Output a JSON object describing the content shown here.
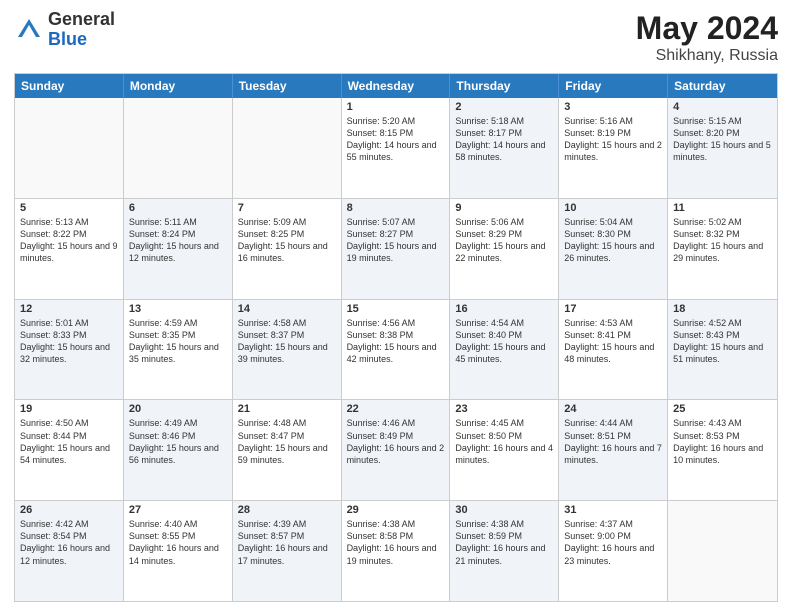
{
  "logo": {
    "general": "General",
    "blue": "Blue"
  },
  "title": {
    "month_year": "May 2024",
    "location": "Shikhany, Russia"
  },
  "header_days": [
    "Sunday",
    "Monday",
    "Tuesday",
    "Wednesday",
    "Thursday",
    "Friday",
    "Saturday"
  ],
  "rows": [
    [
      {
        "day": "",
        "sunrise": "",
        "sunset": "",
        "daylight": "",
        "shaded": false
      },
      {
        "day": "",
        "sunrise": "",
        "sunset": "",
        "daylight": "",
        "shaded": false
      },
      {
        "day": "",
        "sunrise": "",
        "sunset": "",
        "daylight": "",
        "shaded": false
      },
      {
        "day": "1",
        "sunrise": "Sunrise: 5:20 AM",
        "sunset": "Sunset: 8:15 PM",
        "daylight": "Daylight: 14 hours and 55 minutes.",
        "shaded": false
      },
      {
        "day": "2",
        "sunrise": "Sunrise: 5:18 AM",
        "sunset": "Sunset: 8:17 PM",
        "daylight": "Daylight: 14 hours and 58 minutes.",
        "shaded": true
      },
      {
        "day": "3",
        "sunrise": "Sunrise: 5:16 AM",
        "sunset": "Sunset: 8:19 PM",
        "daylight": "Daylight: 15 hours and 2 minutes.",
        "shaded": false
      },
      {
        "day": "4",
        "sunrise": "Sunrise: 5:15 AM",
        "sunset": "Sunset: 8:20 PM",
        "daylight": "Daylight: 15 hours and 5 minutes.",
        "shaded": true
      }
    ],
    [
      {
        "day": "5",
        "sunrise": "Sunrise: 5:13 AM",
        "sunset": "Sunset: 8:22 PM",
        "daylight": "Daylight: 15 hours and 9 minutes.",
        "shaded": false
      },
      {
        "day": "6",
        "sunrise": "Sunrise: 5:11 AM",
        "sunset": "Sunset: 8:24 PM",
        "daylight": "Daylight: 15 hours and 12 minutes.",
        "shaded": true
      },
      {
        "day": "7",
        "sunrise": "Sunrise: 5:09 AM",
        "sunset": "Sunset: 8:25 PM",
        "daylight": "Daylight: 15 hours and 16 minutes.",
        "shaded": false
      },
      {
        "day": "8",
        "sunrise": "Sunrise: 5:07 AM",
        "sunset": "Sunset: 8:27 PM",
        "daylight": "Daylight: 15 hours and 19 minutes.",
        "shaded": true
      },
      {
        "day": "9",
        "sunrise": "Sunrise: 5:06 AM",
        "sunset": "Sunset: 8:29 PM",
        "daylight": "Daylight: 15 hours and 22 minutes.",
        "shaded": false
      },
      {
        "day": "10",
        "sunrise": "Sunrise: 5:04 AM",
        "sunset": "Sunset: 8:30 PM",
        "daylight": "Daylight: 15 hours and 26 minutes.",
        "shaded": true
      },
      {
        "day": "11",
        "sunrise": "Sunrise: 5:02 AM",
        "sunset": "Sunset: 8:32 PM",
        "daylight": "Daylight: 15 hours and 29 minutes.",
        "shaded": false
      }
    ],
    [
      {
        "day": "12",
        "sunrise": "Sunrise: 5:01 AM",
        "sunset": "Sunset: 8:33 PM",
        "daylight": "Daylight: 15 hours and 32 minutes.",
        "shaded": true
      },
      {
        "day": "13",
        "sunrise": "Sunrise: 4:59 AM",
        "sunset": "Sunset: 8:35 PM",
        "daylight": "Daylight: 15 hours and 35 minutes.",
        "shaded": false
      },
      {
        "day": "14",
        "sunrise": "Sunrise: 4:58 AM",
        "sunset": "Sunset: 8:37 PM",
        "daylight": "Daylight: 15 hours and 39 minutes.",
        "shaded": true
      },
      {
        "day": "15",
        "sunrise": "Sunrise: 4:56 AM",
        "sunset": "Sunset: 8:38 PM",
        "daylight": "Daylight: 15 hours and 42 minutes.",
        "shaded": false
      },
      {
        "day": "16",
        "sunrise": "Sunrise: 4:54 AM",
        "sunset": "Sunset: 8:40 PM",
        "daylight": "Daylight: 15 hours and 45 minutes.",
        "shaded": true
      },
      {
        "day": "17",
        "sunrise": "Sunrise: 4:53 AM",
        "sunset": "Sunset: 8:41 PM",
        "daylight": "Daylight: 15 hours and 48 minutes.",
        "shaded": false
      },
      {
        "day": "18",
        "sunrise": "Sunrise: 4:52 AM",
        "sunset": "Sunset: 8:43 PM",
        "daylight": "Daylight: 15 hours and 51 minutes.",
        "shaded": true
      }
    ],
    [
      {
        "day": "19",
        "sunrise": "Sunrise: 4:50 AM",
        "sunset": "Sunset: 8:44 PM",
        "daylight": "Daylight: 15 hours and 54 minutes.",
        "shaded": false
      },
      {
        "day": "20",
        "sunrise": "Sunrise: 4:49 AM",
        "sunset": "Sunset: 8:46 PM",
        "daylight": "Daylight: 15 hours and 56 minutes.",
        "shaded": true
      },
      {
        "day": "21",
        "sunrise": "Sunrise: 4:48 AM",
        "sunset": "Sunset: 8:47 PM",
        "daylight": "Daylight: 15 hours and 59 minutes.",
        "shaded": false
      },
      {
        "day": "22",
        "sunrise": "Sunrise: 4:46 AM",
        "sunset": "Sunset: 8:49 PM",
        "daylight": "Daylight: 16 hours and 2 minutes.",
        "shaded": true
      },
      {
        "day": "23",
        "sunrise": "Sunrise: 4:45 AM",
        "sunset": "Sunset: 8:50 PM",
        "daylight": "Daylight: 16 hours and 4 minutes.",
        "shaded": false
      },
      {
        "day": "24",
        "sunrise": "Sunrise: 4:44 AM",
        "sunset": "Sunset: 8:51 PM",
        "daylight": "Daylight: 16 hours and 7 minutes.",
        "shaded": true
      },
      {
        "day": "25",
        "sunrise": "Sunrise: 4:43 AM",
        "sunset": "Sunset: 8:53 PM",
        "daylight": "Daylight: 16 hours and 10 minutes.",
        "shaded": false
      }
    ],
    [
      {
        "day": "26",
        "sunrise": "Sunrise: 4:42 AM",
        "sunset": "Sunset: 8:54 PM",
        "daylight": "Daylight: 16 hours and 12 minutes.",
        "shaded": true
      },
      {
        "day": "27",
        "sunrise": "Sunrise: 4:40 AM",
        "sunset": "Sunset: 8:55 PM",
        "daylight": "Daylight: 16 hours and 14 minutes.",
        "shaded": false
      },
      {
        "day": "28",
        "sunrise": "Sunrise: 4:39 AM",
        "sunset": "Sunset: 8:57 PM",
        "daylight": "Daylight: 16 hours and 17 minutes.",
        "shaded": true
      },
      {
        "day": "29",
        "sunrise": "Sunrise: 4:38 AM",
        "sunset": "Sunset: 8:58 PM",
        "daylight": "Daylight: 16 hours and 19 minutes.",
        "shaded": false
      },
      {
        "day": "30",
        "sunrise": "Sunrise: 4:38 AM",
        "sunset": "Sunset: 8:59 PM",
        "daylight": "Daylight: 16 hours and 21 minutes.",
        "shaded": true
      },
      {
        "day": "31",
        "sunrise": "Sunrise: 4:37 AM",
        "sunset": "Sunset: 9:00 PM",
        "daylight": "Daylight: 16 hours and 23 minutes.",
        "shaded": false
      },
      {
        "day": "",
        "sunrise": "",
        "sunset": "",
        "daylight": "",
        "shaded": false
      }
    ]
  ]
}
